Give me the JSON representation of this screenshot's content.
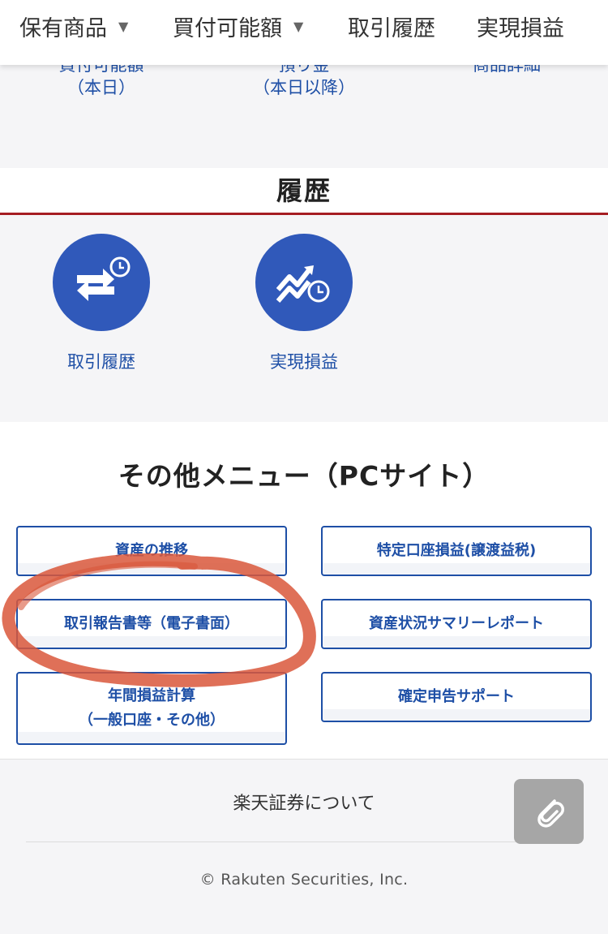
{
  "top_tabs": [
    {
      "label": "保有商品",
      "caret": "▼"
    },
    {
      "label": "買付可能額",
      "caret": "▼"
    },
    {
      "label": "取引履歴"
    },
    {
      "label": "実現損益"
    }
  ],
  "peek_row": [
    {
      "label_top": "買付可能額",
      "label_bottom": "（本日）"
    },
    {
      "label_top": "預り金",
      "label_bottom": "（本日以降）"
    },
    {
      "label_top": "商品詳細",
      "label_bottom": ""
    }
  ],
  "history_section": {
    "title": "履歴",
    "buttons": [
      {
        "label": "取引履歴",
        "icon": "exchange-history-icon"
      },
      {
        "label": "実現損益",
        "icon": "profit-history-icon"
      }
    ]
  },
  "other_menu": {
    "title": "その他メニュー（PCサイト）",
    "buttons": [
      {
        "label": "資産の推移"
      },
      {
        "label": "特定口座損益(譲渡益税)"
      },
      {
        "label": "取引報告書等（電子書面）"
      },
      {
        "label": "資産状況サマリーレポート"
      },
      {
        "label_line1": "年間損益計算",
        "label_line2": "（一般口座・その他）"
      },
      {
        "label": "確定申告サポート"
      }
    ]
  },
  "footer": {
    "about": "楽天証券について",
    "copyright": "© Rakuten Securities, Inc."
  },
  "colors": {
    "brand_blue": "#1e4fa6",
    "circle_blue": "#3059ba",
    "section_red": "#a51d22",
    "highlight_annotation": "#d9573b"
  }
}
